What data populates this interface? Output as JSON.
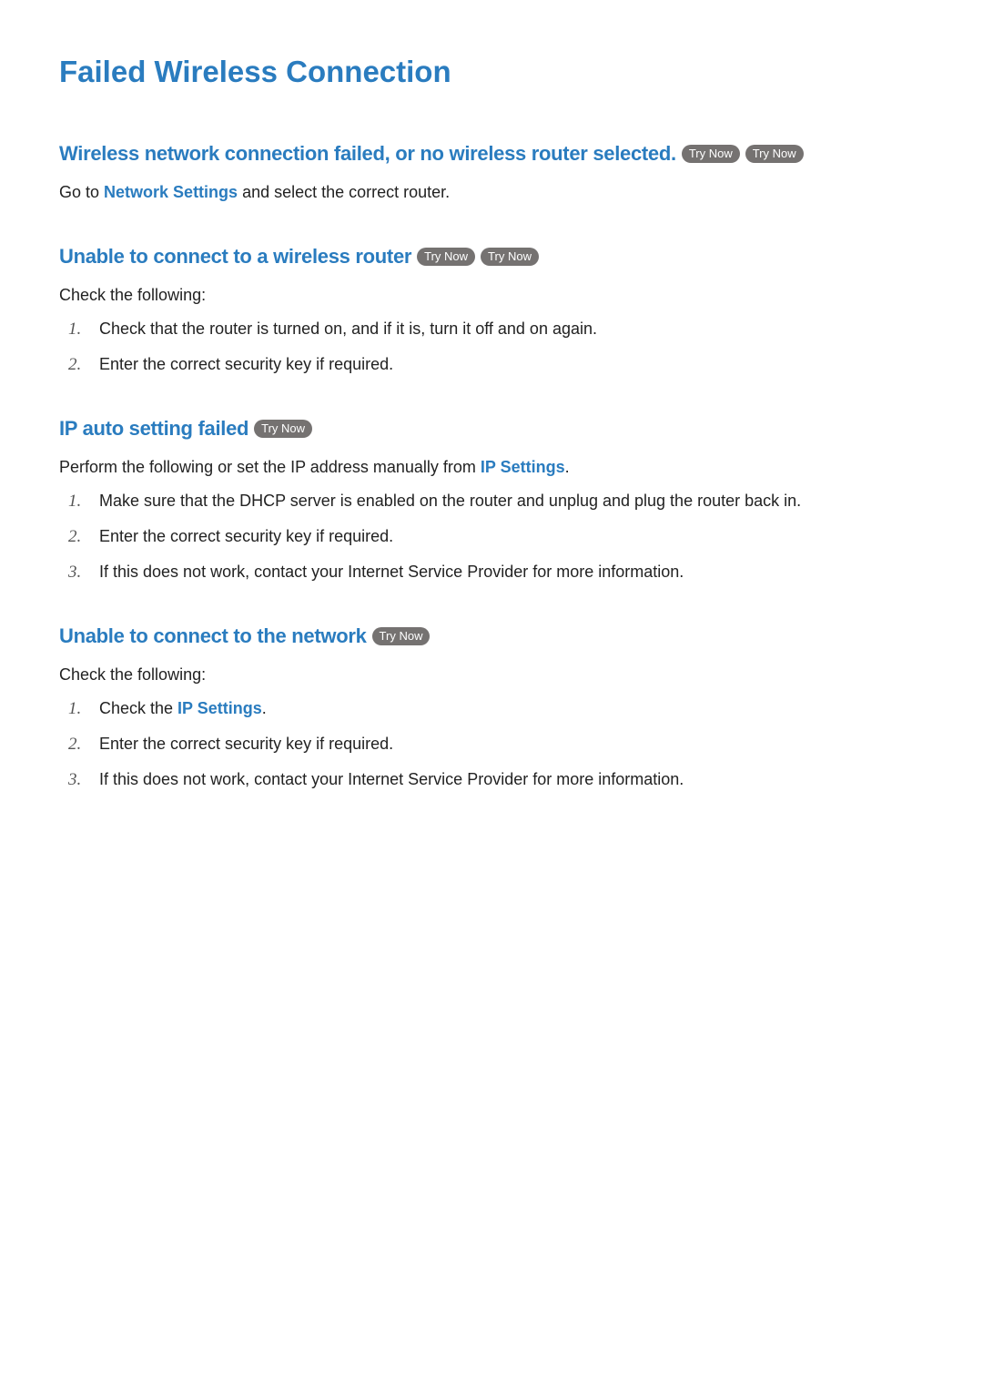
{
  "page": {
    "title": "Failed Wireless Connection"
  },
  "common": {
    "try_now": "Try Now"
  },
  "sections": {
    "s1": {
      "heading": "Wireless network connection failed, or no wireless router selected.",
      "body_prefix": "Go to ",
      "body_link": "Network Settings",
      "body_suffix": " and select the correct router."
    },
    "s2": {
      "heading": "Unable to connect to a wireless router",
      "body": "Check the following:",
      "items": {
        "1": "Check that the router is turned on, and if it is, turn it off and on again.",
        "2": "Enter the correct security key if required."
      }
    },
    "s3": {
      "heading": "IP auto setting failed",
      "body_prefix": "Perform the following or set the IP address manually from ",
      "body_link": "IP Settings",
      "body_suffix": ".",
      "items": {
        "1": "Make sure that the DHCP server is enabled on the router and unplug and plug the router back in.",
        "2": "Enter the correct security key if required.",
        "3": "If this does not work, contact your Internet Service Provider for more information."
      }
    },
    "s4": {
      "heading": "Unable to connect to the network",
      "body": "Check the following:",
      "items": {
        "1_prefix": "Check the ",
        "1_link": "IP Settings",
        "1_suffix": ".",
        "2": "Enter the correct security key if required.",
        "3": "If this does not work, contact your Internet Service Provider for more information."
      }
    }
  },
  "numbers": {
    "n1": "1.",
    "n2": "2.",
    "n3": "3."
  }
}
